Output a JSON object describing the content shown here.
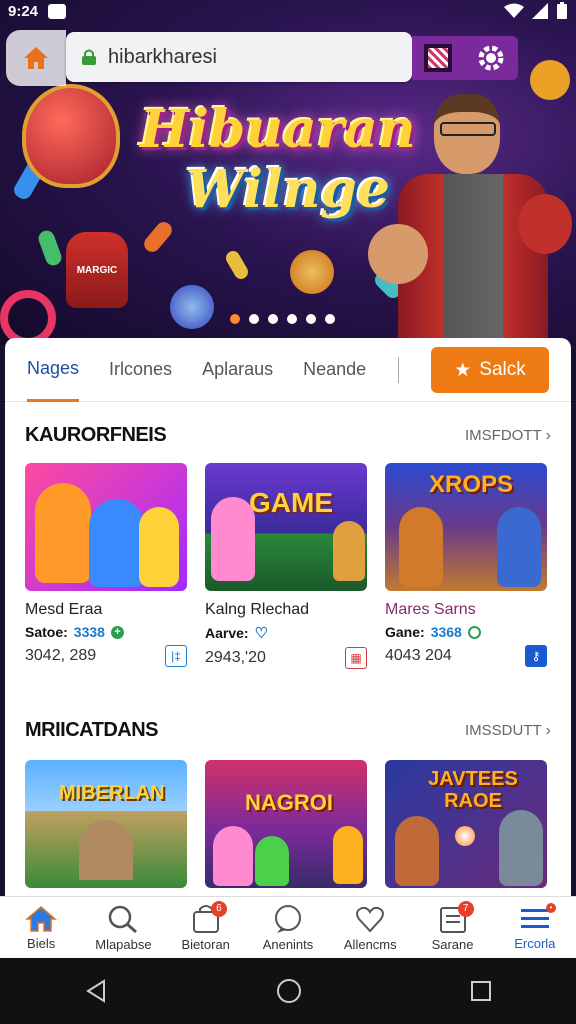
{
  "status_bar": {
    "time": "9:24"
  },
  "browser": {
    "url": "hibarkharesi"
  },
  "hero": {
    "title_line1": "Hibuaran",
    "title_line2": "Wilnge",
    "sign_text": "MARGIC"
  },
  "tabs": [
    {
      "label": "Nages",
      "active": true
    },
    {
      "label": "Irlcones",
      "active": false
    },
    {
      "label": "Aplaraus",
      "active": false
    },
    {
      "label": "Neande",
      "active": false
    }
  ],
  "search_button": {
    "label": "Salck"
  },
  "section1": {
    "title": "KAURORFNEIS",
    "more": "IMSFDOTT",
    "cards": [
      {
        "thumb_label": "",
        "name": "Mesd Eraa",
        "sub_label": "Satoe:",
        "sub_value": "3338",
        "stats": "3042, 289",
        "name_color": "#222"
      },
      {
        "thumb_label": "GAME",
        "name": "Kalng Rlechad",
        "sub_label": "Aarve:",
        "sub_value": "",
        "stats": "2943,'20",
        "name_color": "#222"
      },
      {
        "thumb_label": "XROPS",
        "name": "Mares Sarns",
        "sub_label": "Gane:",
        "sub_value": "3368",
        "stats": "4043 204",
        "name_color": "#8a2a6a"
      }
    ]
  },
  "section2": {
    "title": "MRIICATDANS",
    "more": "IMSSDUTT",
    "cards": [
      {
        "thumb_label": "MIBERLAN"
      },
      {
        "thumb_label": "NAGROI"
      },
      {
        "thumb_label": "JAVTEES RAOE"
      }
    ]
  },
  "bottom_nav": [
    {
      "label": "Biels",
      "icon": "home-icon",
      "badge": "",
      "active": false
    },
    {
      "label": "Mlapabse",
      "icon": "search-icon",
      "badge": "",
      "active": false
    },
    {
      "label": "Bietoran",
      "icon": "bag-icon",
      "badge": "6",
      "active": false
    },
    {
      "label": "Anenints",
      "icon": "chat-icon",
      "badge": "",
      "active": false
    },
    {
      "label": "Allencms",
      "icon": "heart-icon",
      "badge": "",
      "active": false
    },
    {
      "label": "Sarane",
      "icon": "doc-icon",
      "badge": "7",
      "active": false
    },
    {
      "label": "Ercorla",
      "icon": "menu-icon",
      "badge": "•",
      "active": true
    }
  ],
  "colors": {
    "accent": "#ee7a14",
    "link": "#1a5ad0",
    "purple": "#7a2a9a"
  }
}
